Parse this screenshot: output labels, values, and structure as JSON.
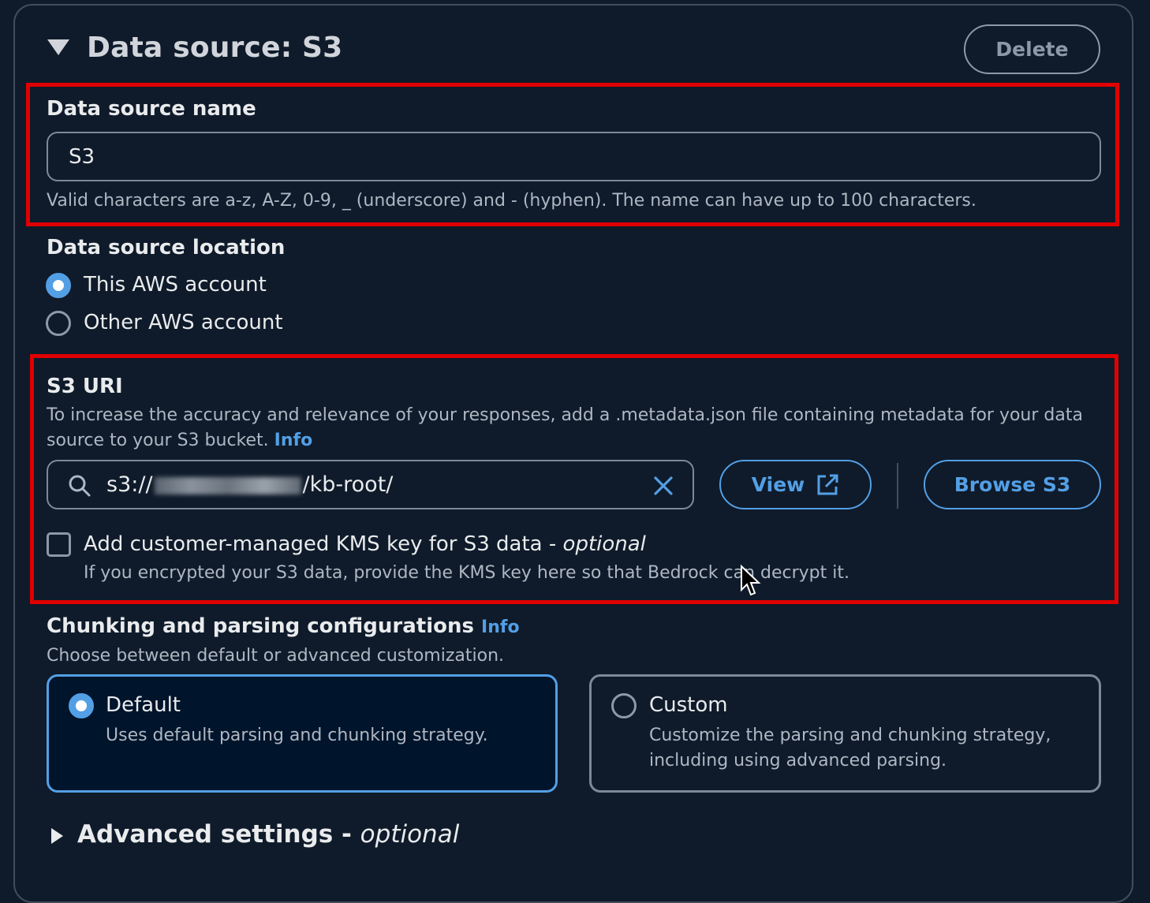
{
  "header": {
    "title": "Data source: S3",
    "delete_label": "Delete"
  },
  "name_field": {
    "label": "Data source name",
    "value": "S3",
    "hint": "Valid characters are a-z, A-Z, 0-9, _ (underscore) and - (hyphen). The name can have up to 100 characters."
  },
  "location": {
    "label": "Data source location",
    "options": [
      {
        "label": "This AWS account",
        "checked": true
      },
      {
        "label": "Other AWS account",
        "checked": false
      }
    ]
  },
  "s3_uri": {
    "label": "S3 URI",
    "description_line1": "To increase the accuracy and relevance of your responses, add a .metadata.json file containing metadata for your data",
    "description_line2": "source to your S3 bucket.",
    "info_label": "Info",
    "value_prefix": "s3://",
    "value_suffix": "/kb-root/",
    "view_label": "View",
    "browse_label": "Browse S3"
  },
  "kms": {
    "label": "Add customer-managed KMS key for S3 data - ",
    "optional": "optional",
    "hint": "If you encrypted your S3 data, provide the KMS key here so that Bedrock can decrypt it.",
    "checked": false
  },
  "chunking": {
    "label": "Chunking and parsing configurations",
    "info_label": "Info",
    "description": "Choose between default or advanced customization.",
    "cards": [
      {
        "title": "Default",
        "line1": "Uses default parsing and chunking strategy.",
        "line2": "",
        "selected": true
      },
      {
        "title": "Custom",
        "line1": "Customize the parsing and chunking strategy,",
        "line2": "including using advanced parsing.",
        "selected": false
      }
    ]
  },
  "advanced": {
    "label": "Advanced settings - ",
    "optional": "optional"
  },
  "colors": {
    "accent": "#539fe5",
    "highlight": "#e00000",
    "background": "#0f1b2a"
  }
}
